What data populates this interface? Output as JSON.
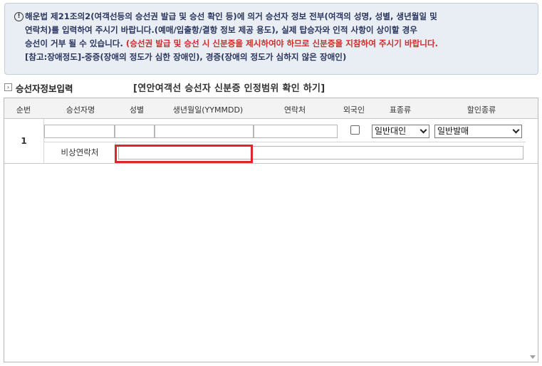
{
  "notice": {
    "icon": "exclamation-circle-icon",
    "line1": "해운법 제21조의2(여객선등의 승선권 발급 및 승선 확인 등)에 의거 승선자 정보 전부(여객의 성명, 성별, 생년월일 및",
    "line2": "연락처)를 입력하여 주시기 바랍니다.(예매/입출항/결항 정보 제공 용도), 실제 탑승자와 인적 사항이 상이할 경우",
    "line3a": "승선이 거부 될 수 있습니다. ",
    "line3b": "(승선권 발급 및 승선 시 신분증을 제시하여야 하므로 신분증을 지참하여 주시기 바랍니다.",
    "line4": "[참고:장애정도]-중증(장애의 정도가 심한 장애인), 경증(장애의 정도가 심하지 않은 장애인)"
  },
  "section": {
    "icon": "chevron-right-icon",
    "title": "승선자정보입력",
    "link": "[연안여객선 승선자 신분증 인정범위 확인 하기]"
  },
  "table": {
    "headers": [
      "순번",
      "승선자명",
      "성별",
      "생년월일(YYMMDD)",
      "연락처",
      "외국인",
      "표종류",
      "할인종류"
    ],
    "rows": [
      {
        "no": "1",
        "name": "",
        "gender": "",
        "birth": "",
        "phone": "",
        "foreigner": false,
        "ticket_type": "일반대인",
        "discount_type": "일반발매",
        "emergency_label": "비상연락처",
        "emergency_value": ""
      }
    ]
  },
  "colors": {
    "highlight": "#e0262c",
    "notice_red": "#d22a2a",
    "notice_blue": "#2a3560"
  }
}
